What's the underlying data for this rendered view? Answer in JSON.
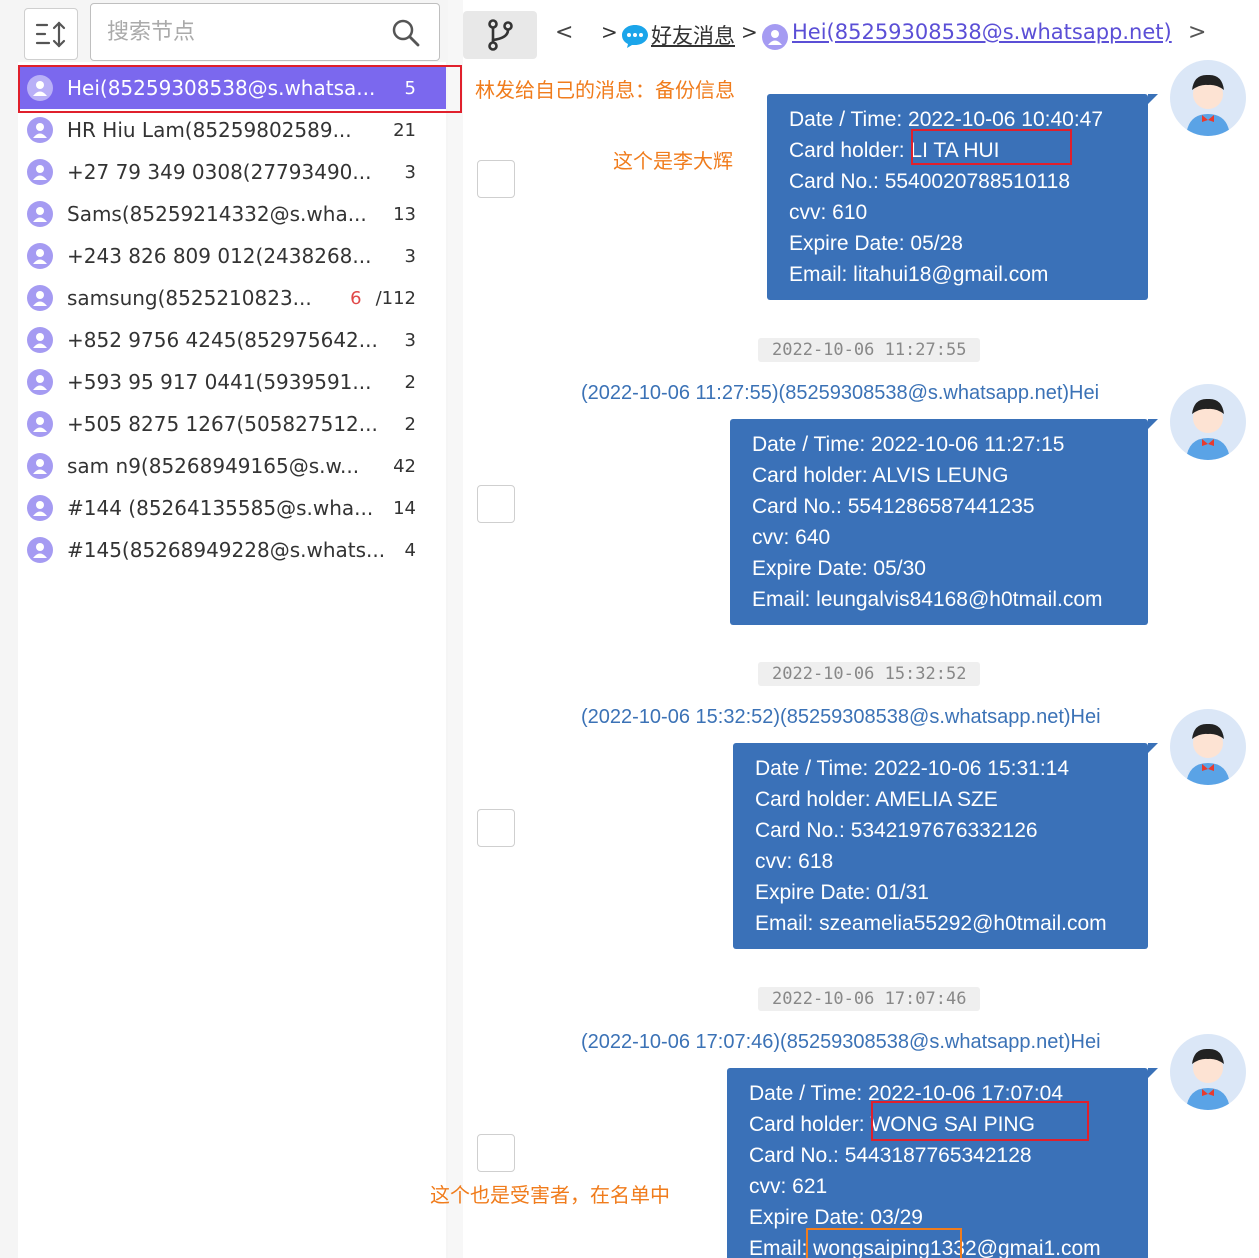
{
  "sidebar": {
    "search_placeholder": "搜索节点",
    "contacts": [
      {
        "name": "Hei(85259308538@s.whatsa...",
        "count": "5",
        "active": true
      },
      {
        "name": "HR Hiu Lam(85259802589...",
        "count": "21"
      },
      {
        "name": "+27 79 349 0308(27793490...",
        "count": "3"
      },
      {
        "name": "Sams(85259214332@s.wha...",
        "count": "13"
      },
      {
        "name": "+243 826 809 012(2438268...",
        "count": "3"
      },
      {
        "name": "samsung(8525210823...",
        "unread": "6",
        "count": "/112"
      },
      {
        "name": "+852 9756 4245(852975642...",
        "count": "3"
      },
      {
        "name": "+593 95 917 0441(5939591...",
        "count": "2"
      },
      {
        "name": "+505 8275 1267(505827512...",
        "count": "2"
      },
      {
        "name": "sam n9(85268949165@s.w...",
        "count": "42"
      },
      {
        "name": "#144 (85264135585@s.wha...",
        "count": "14"
      },
      {
        "name": "#145(85268949228@s.whats...",
        "count": "4"
      }
    ]
  },
  "breadcrumb": {
    "sep1": ">",
    "friends": "好友消息",
    "sep2": ">",
    "contact": "Hei(85259308538@s.whatsapp.net)"
  },
  "annotations": {
    "a1": "林发给自己的消息：备份信息",
    "a2": "这个是李大辉",
    "a3": "这个也是受害者，在名单中"
  },
  "messages": [
    {
      "lines": [
        "Date / Time: 2022-10-06 10:40:47",
        "Card holder: LI TA HUI",
        "Card No.: 5540020788510118",
        "cvv: 610",
        "Expire Date: 05/28",
        "Email: litahui18@gmail.com"
      ]
    },
    {
      "time": "2022-10-06 11:27:55",
      "sender": "(2022-10-06 11:27:55)(85259308538@s.whatsapp.net)Hei",
      "lines": [
        "Date / Time: 2022-10-06 11:27:15",
        "Card holder: ALVIS LEUNG",
        "Card No.: 5541286587441235",
        "cvv: 640",
        "Expire Date: 05/30",
        "Email: leungalvis84168@h0tmail.com"
      ]
    },
    {
      "time": "2022-10-06 15:32:52",
      "sender": "(2022-10-06 15:32:52)(85259308538@s.whatsapp.net)Hei",
      "lines": [
        "Date / Time: 2022-10-06 15:31:14",
        "Card holder: AMELIA SZE",
        "Card No.: 5342197676332126",
        "cvv: 618",
        "Expire Date: 01/31",
        "Email: szeamelia55292@h0tmail.com"
      ]
    },
    {
      "time": "2022-10-06 17:07:46",
      "sender": "(2022-10-06 17:07:46)(85259308538@s.whatsapp.net)Hei",
      "lines": [
        "Date / Time: 2022-10-06 17:07:04",
        "Card holder: WONG SAI PING",
        "Card No.: 5443187765342128",
        "cvv: 621",
        "Expire Date: 03/29",
        "Email: wongsaiping1332@gmai1.com"
      ]
    }
  ],
  "colors": {
    "accent": "#7b68ee",
    "bubble": "#3a71b8",
    "annotation": "#f07c1c",
    "highlight_box": "#e0202c"
  }
}
